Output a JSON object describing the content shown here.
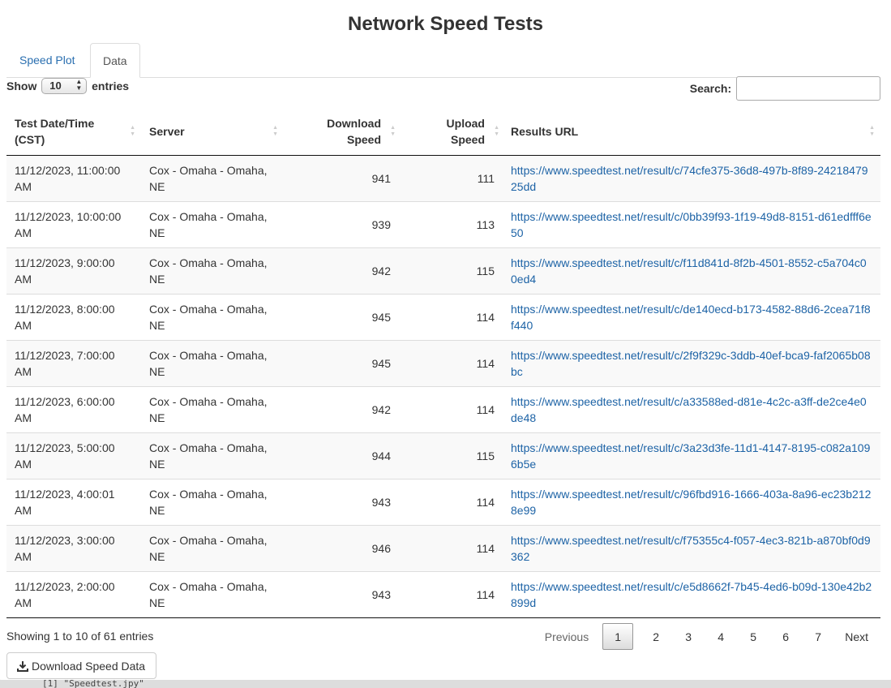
{
  "title": "Network Speed Tests",
  "tabs": [
    {
      "label": "Speed Plot",
      "active": false
    },
    {
      "label": "Data",
      "active": true
    }
  ],
  "length": {
    "show": "Show",
    "value": "10",
    "entries": "entries"
  },
  "search": {
    "label": "Search:",
    "value": ""
  },
  "table": {
    "headers": [
      {
        "l1": "Test Date/Time",
        "l2": "(CST)"
      },
      {
        "l1": "Server",
        "l2": ""
      },
      {
        "l1": "Download",
        "l2": "Speed"
      },
      {
        "l1": "Upload",
        "l2": "Speed"
      },
      {
        "l1": "Results URL",
        "l2": ""
      }
    ],
    "rows": [
      {
        "date": "11/12/2023, 11:00:00 AM",
        "server": "Cox - Omaha - Omaha, NE",
        "download": "941",
        "upload": "111",
        "url": "https://www.speedtest.net/result/c/74cfe375-36d8-497b-8f89-2421847925dd"
      },
      {
        "date": "11/12/2023, 10:00:00 AM",
        "server": "Cox - Omaha - Omaha, NE",
        "download": "939",
        "upload": "113",
        "url": "https://www.speedtest.net/result/c/0bb39f93-1f19-49d8-8151-d61edfff6e50"
      },
      {
        "date": "11/12/2023, 9:00:00 AM",
        "server": "Cox - Omaha - Omaha, NE",
        "download": "942",
        "upload": "115",
        "url": "https://www.speedtest.net/result/c/f11d841d-8f2b-4501-8552-c5a704c00ed4"
      },
      {
        "date": "11/12/2023, 8:00:00 AM",
        "server": "Cox - Omaha - Omaha, NE",
        "download": "945",
        "upload": "114",
        "url": "https://www.speedtest.net/result/c/de140ecd-b173-4582-88d6-2cea71f8f440"
      },
      {
        "date": "11/12/2023, 7:00:00 AM",
        "server": "Cox - Omaha - Omaha, NE",
        "download": "945",
        "upload": "114",
        "url": "https://www.speedtest.net/result/c/2f9f329c-3ddb-40ef-bca9-faf2065b08bc"
      },
      {
        "date": "11/12/2023, 6:00:00 AM",
        "server": "Cox - Omaha - Omaha, NE",
        "download": "942",
        "upload": "114",
        "url": "https://www.speedtest.net/result/c/a33588ed-d81e-4c2c-a3ff-de2ce4e0de48"
      },
      {
        "date": "11/12/2023, 5:00:00 AM",
        "server": "Cox - Omaha - Omaha, NE",
        "download": "944",
        "upload": "115",
        "url": "https://www.speedtest.net/result/c/3a23d3fe-11d1-4147-8195-c082a1096b5e"
      },
      {
        "date": "11/12/2023, 4:00:01 AM",
        "server": "Cox - Omaha - Omaha, NE",
        "download": "943",
        "upload": "114",
        "url": "https://www.speedtest.net/result/c/96fbd916-1666-403a-8a96-ec23b2128e99"
      },
      {
        "date": "11/12/2023, 3:00:00 AM",
        "server": "Cox - Omaha - Omaha, NE",
        "download": "946",
        "upload": "114",
        "url": "https://www.speedtest.net/result/c/f75355c4-f057-4ec3-821b-a870bf0d9362"
      },
      {
        "date": "11/12/2023, 2:00:00 AM",
        "server": "Cox - Omaha - Omaha, NE",
        "download": "943",
        "upload": "114",
        "url": "https://www.speedtest.net/result/c/e5d8662f-7b45-4ed6-b09d-130e42b2899d"
      }
    ]
  },
  "info": "Showing 1 to 10 of 61 entries",
  "pager": {
    "previous": "Previous",
    "pages": [
      "1",
      "2",
      "3",
      "4",
      "5",
      "6",
      "7"
    ],
    "current": "1",
    "next": "Next"
  },
  "download_button": {
    "label": "Download Speed Data",
    "icon": "download-icon"
  },
  "background_console": "[1] \"Speedtest.jpy\"",
  "colors": {
    "link": "#1d63a6",
    "tab_active_text": "#555555",
    "striped_row": "#f9f9f9"
  }
}
